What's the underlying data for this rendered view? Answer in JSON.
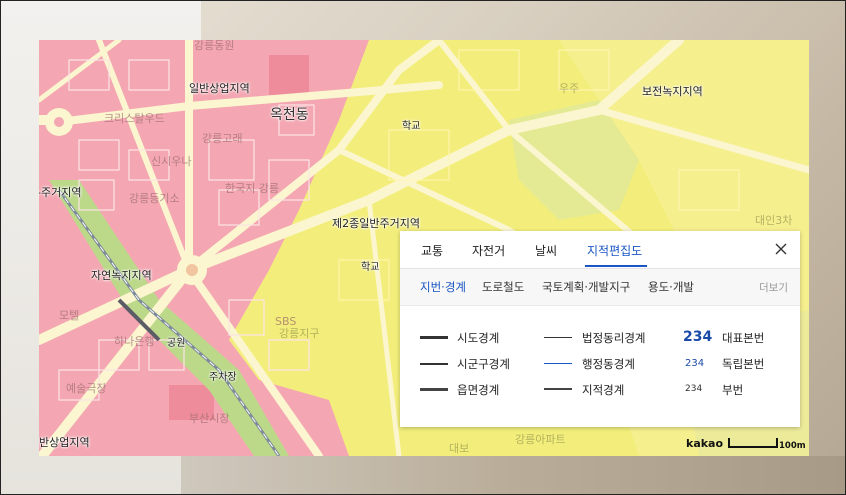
{
  "map": {
    "labels": {
      "ilban_sangeop_top": "일반상업지역",
      "okcheon": "옥천동",
      "school_1": "학교",
      "bojeon_nokji": "보전녹지지역",
      "jugeo_left": "-주거지역",
      "je2jong": "제2종일반주거지역",
      "jayeon_nokji": "자연녹지지역",
      "school_2": "학교",
      "park": "공원",
      "parking": "주차장",
      "ilban_sangeop_bottom": "반상업지역"
    },
    "faint_labels": {
      "a1": "강릉동원",
      "a2": "크리스탈우드",
      "a3": "신시우나",
      "a4": "강릉고래",
      "a5": "한국지 강릉",
      "a6": "강릉등기소",
      "a7": "모텔",
      "a8": "부산시장",
      "a9": "하나은행",
      "a10": "예술극장",
      "a11": "SBS",
      "a12": "대인3차",
      "a13": "우주",
      "a14": "강릉지구",
      "a15": "강릉아파트",
      "a16": "대보"
    },
    "zone_colors": {
      "commercial": "#f4a7b2",
      "residential": "#f3ee7b",
      "green": "#cfe29a",
      "road": "#fbf6cf"
    },
    "branding": {
      "logo": "kakao",
      "scale_label": "100m"
    }
  },
  "panel": {
    "tabs": [
      "교통",
      "자전거",
      "날씨",
      "지적편집도"
    ],
    "active_tab": "지적편집도",
    "subtabs": [
      "지번·경계",
      "도로철도",
      "국토계획·개발지구",
      "용도·개발"
    ],
    "active_subtab": "지번·경계",
    "more_label": "더보기",
    "close_icon": "close-icon",
    "legend": {
      "col1": [
        {
          "label": "시도경계"
        },
        {
          "label": "시군구경계"
        },
        {
          "label": "읍면경계"
        }
      ],
      "col2": [
        {
          "label": "법정동리경계"
        },
        {
          "label": "행정동경계",
          "color": "#1a56c5"
        },
        {
          "label": "지적경계"
        }
      ],
      "col3": [
        {
          "num": "234",
          "label": "대표본번"
        },
        {
          "num": "234",
          "label": "독립본번"
        },
        {
          "num": "234",
          "label": "부번"
        }
      ]
    }
  }
}
